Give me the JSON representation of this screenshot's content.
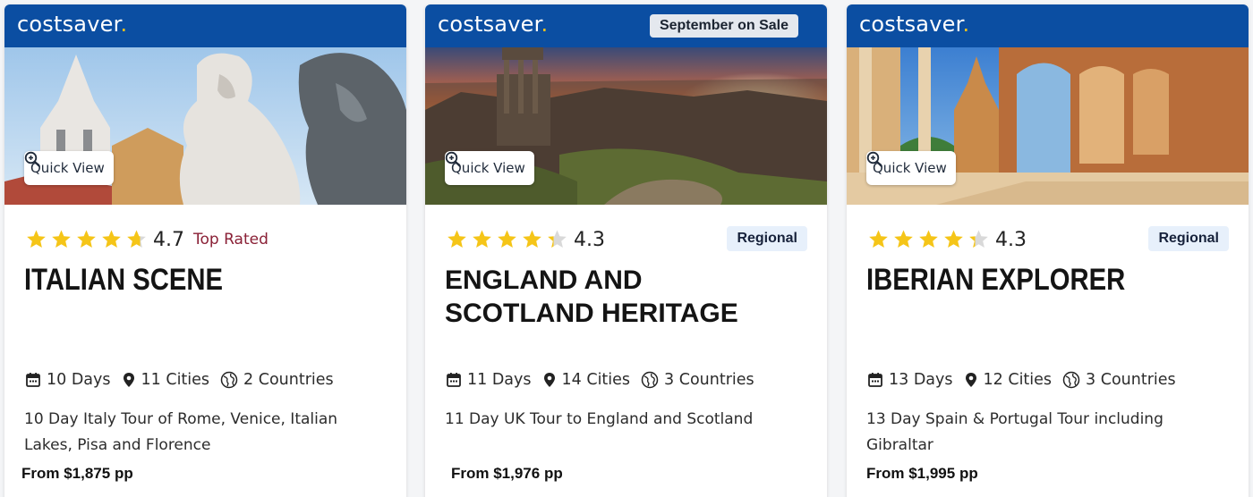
{
  "cards": [
    {
      "logo": "costsaver",
      "sale_badge": "",
      "quick_view": "Quick View",
      "rating": "4.7",
      "rating_stars": 4.7,
      "tag": "Top Rated",
      "title": "ITALIAN SCENE",
      "days": "10 Days",
      "cities": "11 Cities",
      "countries": "2 Countries",
      "description": "10 Day Italy Tour of Rome, Venice, Italian Lakes, Pisa and Florence",
      "price": "From $1,875 pp"
    },
    {
      "logo": "costsaver",
      "sale_badge": "September on Sale",
      "quick_view": "Quick View",
      "rating": "4.3",
      "rating_stars": 4.3,
      "regional": "Regional",
      "title": "ENGLAND AND SCOTLAND HERITAGE",
      "days": "11 Days",
      "cities": "14 Cities",
      "countries": "3 Countries",
      "description": "11 Day UK Tour to England and Scotland",
      "price": "From $1,976 pp"
    },
    {
      "logo": "costsaver",
      "sale_badge": "",
      "quick_view": "Quick View",
      "rating": "4.3",
      "rating_stars": 4.3,
      "regional": "Regional",
      "title": "IBERIAN EXPLORER",
      "days": "13 Days",
      "cities": "12 Cities",
      "countries": "3 Countries",
      "description": "13 Day Spain & Portugal Tour including Gibraltar",
      "price": "From $1,995 pp"
    }
  ],
  "colors": {
    "brand_bar": "#0b4ea2",
    "logo_dot": "#f7c31a",
    "star": "#f5c518",
    "top_rated": "#8a2036",
    "regional_bg": "#e7f0fb"
  },
  "icons": [
    "calendar-icon",
    "location-pin-icon",
    "globe-icon",
    "zoom-in-icon",
    "star-icon"
  ]
}
